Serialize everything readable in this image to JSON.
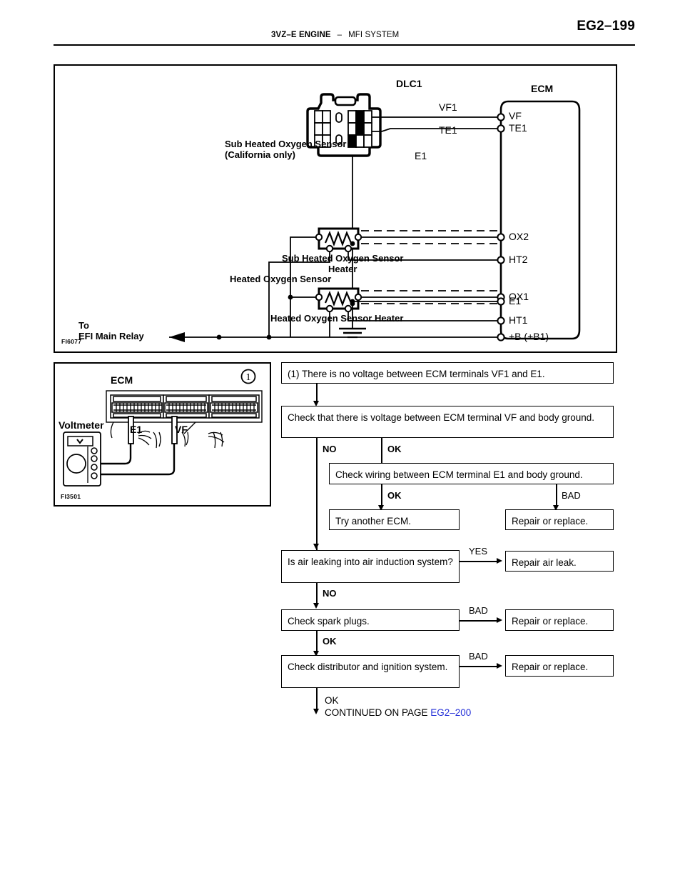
{
  "header": {
    "page_number": "EG2–199",
    "engine": "3VZ–E ENGINE",
    "separator": "–",
    "system": "MFI SYSTEM"
  },
  "wiring_diagram": {
    "figure_id": "FI6077",
    "connector_label": "DLC1",
    "ecm_label": "ECM",
    "dlc_pins": [
      "VF1",
      "TE1",
      "E1"
    ],
    "sensor_labels": [
      "Sub Heated Oxygen Sensor",
      "(California only)",
      "Sub Heated Oxygen Sensor",
      "Heater",
      "Heated Oxygen Sensor",
      "Heated Oxygen Sensor Heater"
    ],
    "relay_label_line1": "To",
    "relay_label_line2": "EFI Main Relay",
    "ecm_terminals": [
      "VF",
      "TE1",
      "OX2",
      "HT2",
      "OX1",
      "HT1",
      "+B (+B1)",
      "E1"
    ]
  },
  "photo_panel": {
    "figure_id": "FI3501",
    "step_marker": "1",
    "ecm_label": "ECM",
    "voltmeter_label": "Voltmeter",
    "probe_labels": [
      "E1",
      "VF"
    ]
  },
  "flowchart": {
    "step1": "(1) There is no voltage between ECM terminals VF1 and E1.",
    "step2": "Check that there is voltage between ECM terminal VF and body ground.",
    "branch_no": "NO",
    "branch_ok_1": "OK",
    "step3": "Check wiring between ECM terminal E1 and body ground.",
    "branch_ok_2": "OK",
    "branch_bad_1": "BAD",
    "result_try_ecm": "Try another ECM.",
    "result_repair_1": "Repair or replace.",
    "step4": "Is air leaking into air induction system?",
    "branch_yes": "YES",
    "result_air_leak": "Repair air leak.",
    "branch_no_2": "NO",
    "step5": "Check spark plugs.",
    "branch_bad_2": "BAD",
    "result_repair_2": "Repair or replace.",
    "branch_ok_3": "OK",
    "step6": "Check distributor and ignition system.",
    "branch_bad_3": "BAD",
    "result_repair_3": "Repair or replace.",
    "final_ok": "OK",
    "continued_prefix": "CONTINUED ON PAGE ",
    "continued_page": "EG2–200"
  },
  "colors": {
    "link": "#2430d8",
    "ink": "#000000"
  }
}
